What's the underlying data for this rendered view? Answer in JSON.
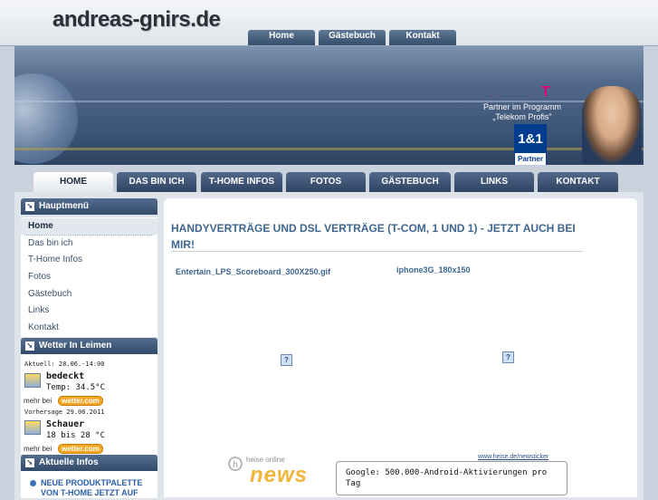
{
  "header": {
    "site_title": "andreas-gnirs.de",
    "top_tabs": [
      "Home",
      "Gästebuch",
      "Kontakt"
    ]
  },
  "banner": {
    "telekom_dots": "· · · · ·",
    "telekom_mark": "T",
    "partner_line1": "Partner im Programm",
    "partner_line2": "„Telekom Profis\"",
    "logo_main": "1&1",
    "logo_sub": "Partner"
  },
  "main_nav": [
    "HOME",
    "DAS BIN ICH",
    "T-HOME INFOS",
    "FOTOS",
    "GÄSTEBUCH",
    "LINKS",
    "KONTAKT"
  ],
  "sidebar": {
    "menu_title": "Hauptmenü",
    "menu_items": [
      "Home",
      "Das bin ich",
      "T-Home Infos",
      "Fotos",
      "Gästebuch",
      "Links",
      "Kontakt"
    ],
    "weather_title": "Wetter In Leimen",
    "weather_now_header": "Aktuell: 28.06.-14:00",
    "weather_now_condition": "bedeckt",
    "weather_now_temp": "Temp: 34.5°C",
    "weather_source_label": "mehr bei",
    "weather_source_badge": "wetter.com",
    "weather_forecast_header": "Vorhersage 29.06.2011",
    "weather_forecast_condition": "Schauer",
    "weather_forecast_range": "18 bis 28 °C",
    "infos_title": "Aktuelle Infos",
    "infos_item": "NEUE PRODUKTPALETTE VON T-HOME JETZT AUF"
  },
  "content": {
    "headline": "HANDYVERTRÄGE UND DSL VERTRÄGE (T-COM, 1 UND 1) - JETZT AUCH BEI MIR!",
    "image1_label": "Entertain_LPS_Scoreboard_300X250.gif",
    "image2_label": "iphone3G_180x150",
    "broken_icon": "?",
    "news_link": "www.heise.de/newsticker",
    "news_logo_circle": "h",
    "news_logo_top": "heise online",
    "news_logo_word": "news",
    "news_text": "Google: 500.000-Android-Aktivierungen pro Tag"
  }
}
